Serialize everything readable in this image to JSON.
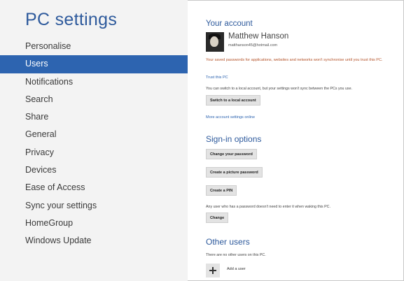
{
  "sidebar": {
    "title": "PC settings",
    "items": [
      {
        "label": "Personalise",
        "selected": false
      },
      {
        "label": "Users",
        "selected": true
      },
      {
        "label": "Notifications",
        "selected": false
      },
      {
        "label": "Search",
        "selected": false
      },
      {
        "label": "Share",
        "selected": false
      },
      {
        "label": "General",
        "selected": false
      },
      {
        "label": "Privacy",
        "selected": false
      },
      {
        "label": "Devices",
        "selected": false
      },
      {
        "label": "Ease of Access",
        "selected": false
      },
      {
        "label": "Sync your settings",
        "selected": false
      },
      {
        "label": "HomeGroup",
        "selected": false
      },
      {
        "label": "Windows Update",
        "selected": false
      }
    ]
  },
  "account": {
    "title": "Your account",
    "user_name": "Matthew Hanson",
    "user_email": "matthanson45@hotmail.com",
    "warning": "Your saved passwords for applications, websites and networks won't synchronise until you trust this PC.",
    "trust_link": "Trust this PC",
    "local_note": "You can switch to a local account, but your settings won't sync between the PCs you use.",
    "switch_button": "Switch to a local account",
    "more_link": "More account settings online"
  },
  "signin": {
    "title": "Sign-in options",
    "change_password_button": "Change your password",
    "picture_password_button": "Create a picture password",
    "pin_button": "Create a PIN",
    "wake_note": "Any user who has a password doesn't need to enter it when waking this PC.",
    "change_button": "Change"
  },
  "other_users": {
    "title": "Other users",
    "none_note": "There are no other users on this PC.",
    "add_user_label": "Add a user"
  },
  "colors": {
    "accent": "#2d64b0",
    "title_blue": "#2e5a9c",
    "warning": "#b5552c",
    "sidebar_bg": "#f3f3f3"
  }
}
